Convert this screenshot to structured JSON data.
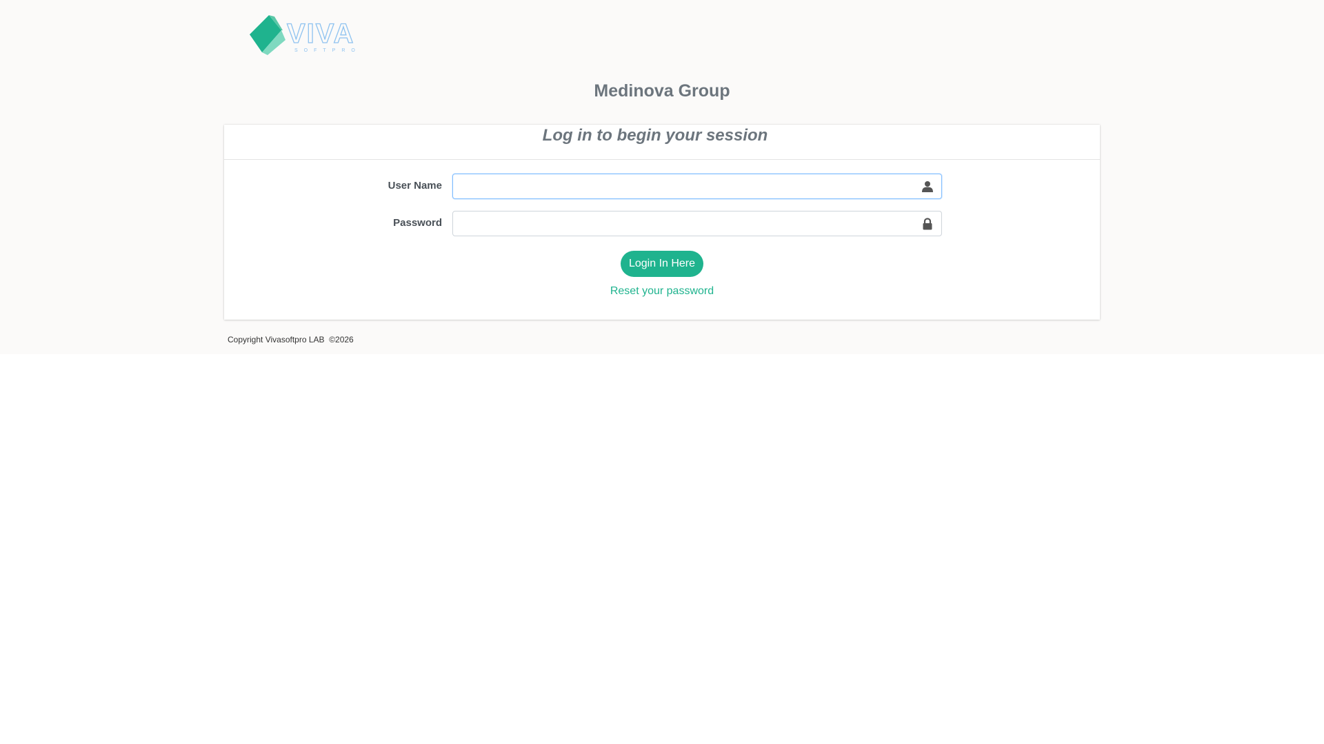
{
  "header": {
    "logo_text": "VIVA",
    "logo_subtext": "SOFTPRO",
    "org_title": "Medinova Group"
  },
  "login_card": {
    "title": "Log in to begin your session",
    "username": {
      "label": "User Name",
      "value": "",
      "icon": "user-icon"
    },
    "password": {
      "label": "Password",
      "value": "",
      "icon": "lock-icon"
    },
    "login_button": "Login In Here",
    "reset_link": "Reset your password"
  },
  "footer": {
    "copyright": "Copyright Vivasoftpro LAB  ©2026"
  },
  "colors": {
    "accent": "#1fb38e",
    "logo_outline": "#8fc3f0",
    "title_gray": "#6c757d",
    "page_bg": "#fbfaf9"
  }
}
